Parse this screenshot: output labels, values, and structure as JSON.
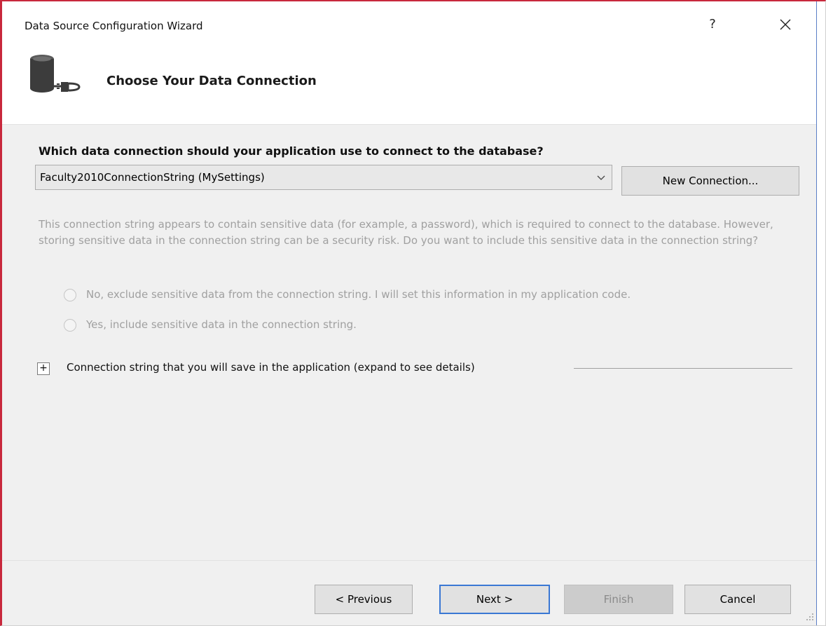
{
  "window": {
    "title": "Data Source Configuration Wizard",
    "help_label": "?",
    "accent_color": "#c8283c"
  },
  "header": {
    "title": "Choose Your Data Connection",
    "icon": "database-connection-icon"
  },
  "connection": {
    "question": "Which data connection should your application use to connect to the database?",
    "selected_value": "Faculty2010ConnectionString (MySettings)",
    "new_connection_label": "New Connection..."
  },
  "sensitive": {
    "info": "This connection string appears to contain sensitive data (for example, a password), which is required to connect to the database. However, storing sensitive data in the connection string can be a security risk. Do you want to include this sensitive data in the connection string?",
    "options": [
      {
        "label": "No, exclude sensitive data from the connection string. I will set this information in my application code.",
        "selected": false
      },
      {
        "label": "Yes, include sensitive data in the connection string.",
        "selected": false
      }
    ]
  },
  "expander": {
    "symbol": "+",
    "label": "Connection string that you will save in the application (expand to see details)"
  },
  "footer": {
    "previous_label": "< Previous",
    "next_label": "Next >",
    "finish_label": "Finish",
    "cancel_label": "Cancel"
  }
}
